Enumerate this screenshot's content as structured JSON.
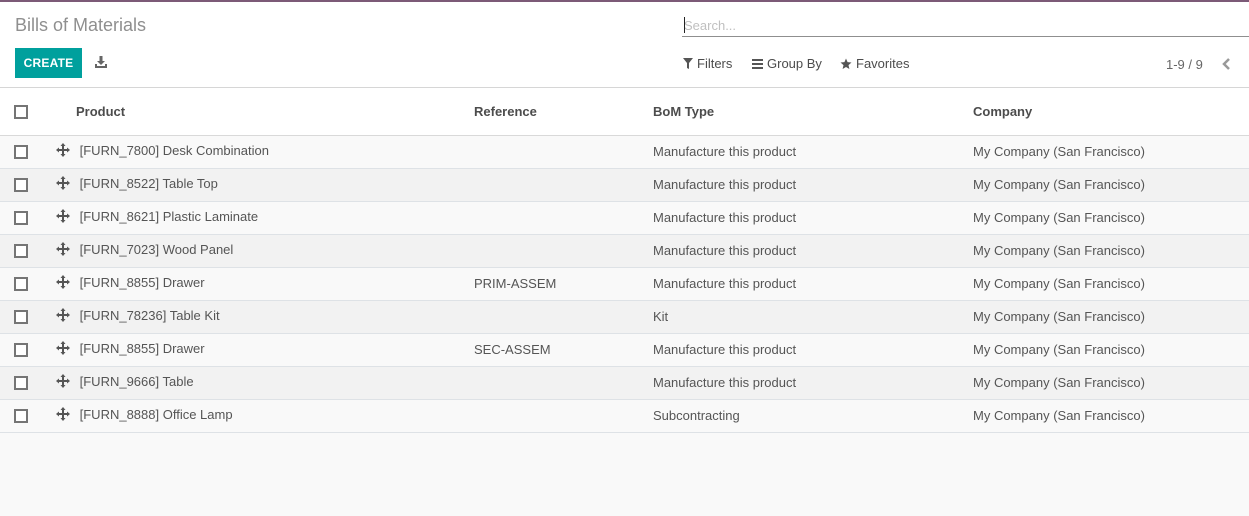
{
  "header": {
    "title": "Bills of Materials",
    "create_label": "CREATE",
    "download_icon": "download-icon"
  },
  "search": {
    "placeholder": "Search...",
    "value": ""
  },
  "search_panel": {
    "filters_label": "Filters",
    "groupby_label": "Group By",
    "favorites_label": "Favorites"
  },
  "pager": {
    "value": "1-9 / 9"
  },
  "list": {
    "columns": [
      "Product",
      "Reference",
      "BoM Type",
      "Company"
    ],
    "rows": [
      {
        "product": "[FURN_7800] Desk Combination",
        "reference": "",
        "bom_type": "Manufacture this product",
        "company": "My Company (San Francisco)"
      },
      {
        "product": "[FURN_8522] Table Top",
        "reference": "",
        "bom_type": "Manufacture this product",
        "company": "My Company (San Francisco)"
      },
      {
        "product": "[FURN_8621] Plastic Laminate",
        "reference": "",
        "bom_type": "Manufacture this product",
        "company": "My Company (San Francisco)"
      },
      {
        "product": "[FURN_7023] Wood Panel",
        "reference": "",
        "bom_type": "Manufacture this product",
        "company": "My Company (San Francisco)"
      },
      {
        "product": "[FURN_8855] Drawer",
        "reference": "PRIM-ASSEM",
        "bom_type": "Manufacture this product",
        "company": "My Company (San Francisco)"
      },
      {
        "product": "[FURN_78236] Table Kit",
        "reference": "",
        "bom_type": "Kit",
        "company": "My Company (San Francisco)"
      },
      {
        "product": "[FURN_8855] Drawer",
        "reference": "SEC-ASSEM",
        "bom_type": "Manufacture this product",
        "company": "My Company (San Francisco)"
      },
      {
        "product": "[FURN_9666] Table",
        "reference": "",
        "bom_type": "Manufacture this product",
        "company": "My Company (San Francisco)"
      },
      {
        "product": "[FURN_8888] Office Lamp",
        "reference": "",
        "bom_type": "Subcontracting",
        "company": "My Company (San Francisco)"
      }
    ]
  },
  "colors": {
    "accent": "#00a09d",
    "topbar": "#7c5a77"
  }
}
